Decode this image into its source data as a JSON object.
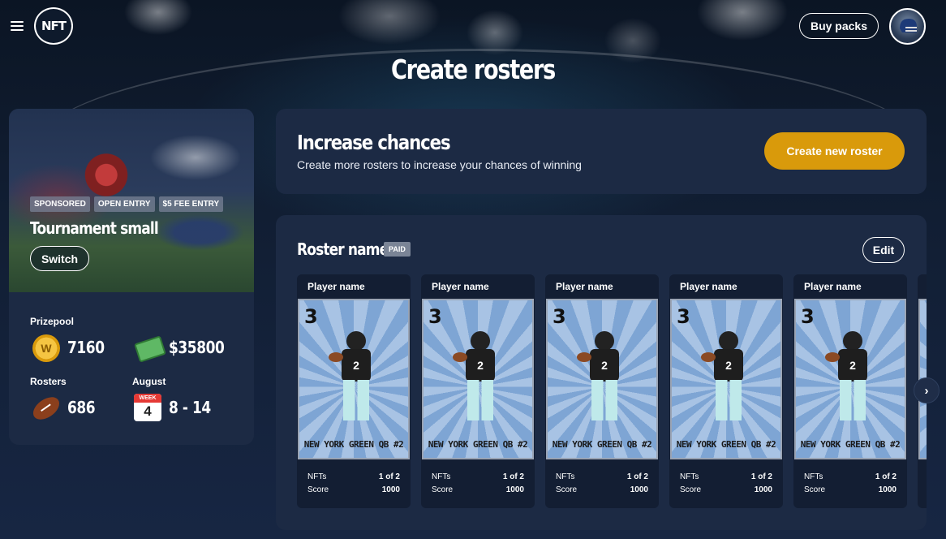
{
  "header": {
    "logo_text": "NFT",
    "buy_packs_label": "Buy packs",
    "page_title": "Create rosters"
  },
  "tournament": {
    "tags": [
      "SPONSORED",
      "OPEN ENTRY",
      "$5 FEE ENTRY"
    ],
    "name": "Tournament small",
    "switch_label": "Switch",
    "prizepool_label": "Prizepool",
    "coin_value": "7160",
    "coin_icon_letter": "W",
    "cash_value": "$35800",
    "rosters_label": "Rosters",
    "rosters_value": "686",
    "month_label": "August",
    "calendar_header": "WEEK",
    "calendar_number": "4",
    "date_range": "8 - 14"
  },
  "increase": {
    "title": "Increase chances",
    "subtitle": "Create more rosters to increase your chances of winning",
    "create_label": "Create new roster"
  },
  "roster": {
    "title": "Roster name",
    "badge": "PAID",
    "edit_label": "Edit",
    "cards": [
      {
        "header": "Player name",
        "number": "3",
        "jersey": "2",
        "caption": "NEW YORK GREEN QB #2",
        "nfts_label": "NFTs",
        "nfts_value": "1 of 2",
        "score_label": "Score",
        "score_value": "1000"
      },
      {
        "header": "Player name",
        "number": "3",
        "jersey": "2",
        "caption": "NEW YORK GREEN QB #2",
        "nfts_label": "NFTs",
        "nfts_value": "1 of 2",
        "score_label": "Score",
        "score_value": "1000"
      },
      {
        "header": "Player name",
        "number": "3",
        "jersey": "2",
        "caption": "NEW YORK GREEN QB #2",
        "nfts_label": "NFTs",
        "nfts_value": "1 of 2",
        "score_label": "Score",
        "score_value": "1000"
      },
      {
        "header": "Player name",
        "number": "3",
        "jersey": "2",
        "caption": "NEW YORK GREEN QB #2",
        "nfts_label": "NFTs",
        "nfts_value": "1 of 2",
        "score_label": "Score",
        "score_value": "1000"
      },
      {
        "header": "Player name",
        "number": "3",
        "jersey": "2",
        "caption": "NEW YORK GREEN QB #2",
        "nfts_label": "NFTs",
        "nfts_value": "1 of 2",
        "score_label": "Score",
        "score_value": "1000"
      }
    ]
  },
  "colors": {
    "accent": "#d99a0b",
    "panel": "#1c2a44",
    "background": "#111e33"
  },
  "icons": [
    "menu-icon",
    "avatar-helmet-icon",
    "coin-icon",
    "cash-icon",
    "football-icon",
    "calendar-icon",
    "chevron-right-icon"
  ]
}
